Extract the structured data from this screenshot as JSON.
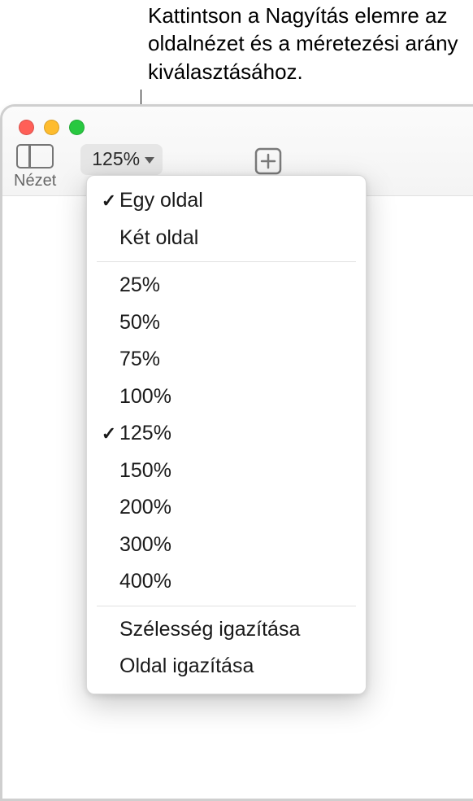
{
  "callout": "Kattintson a Nagyítás elemre az oldalnézet és a méretezési arány kiválasztásához.",
  "toolbar": {
    "view_label": "Nézet",
    "zoom_value": "125%"
  },
  "menu": {
    "page_view": [
      {
        "label": "Egy oldal",
        "checked": true
      },
      {
        "label": "Két oldal",
        "checked": false
      }
    ],
    "zoom_levels": [
      {
        "label": "25%",
        "checked": false
      },
      {
        "label": "50%",
        "checked": false
      },
      {
        "label": "75%",
        "checked": false
      },
      {
        "label": "100%",
        "checked": false
      },
      {
        "label": "125%",
        "checked": true
      },
      {
        "label": "150%",
        "checked": false
      },
      {
        "label": "200%",
        "checked": false
      },
      {
        "label": "300%",
        "checked": false
      },
      {
        "label": "400%",
        "checked": false
      }
    ],
    "fit": [
      {
        "label": "Szélesség igazítása"
      },
      {
        "label": "Oldal igazítása"
      }
    ]
  }
}
